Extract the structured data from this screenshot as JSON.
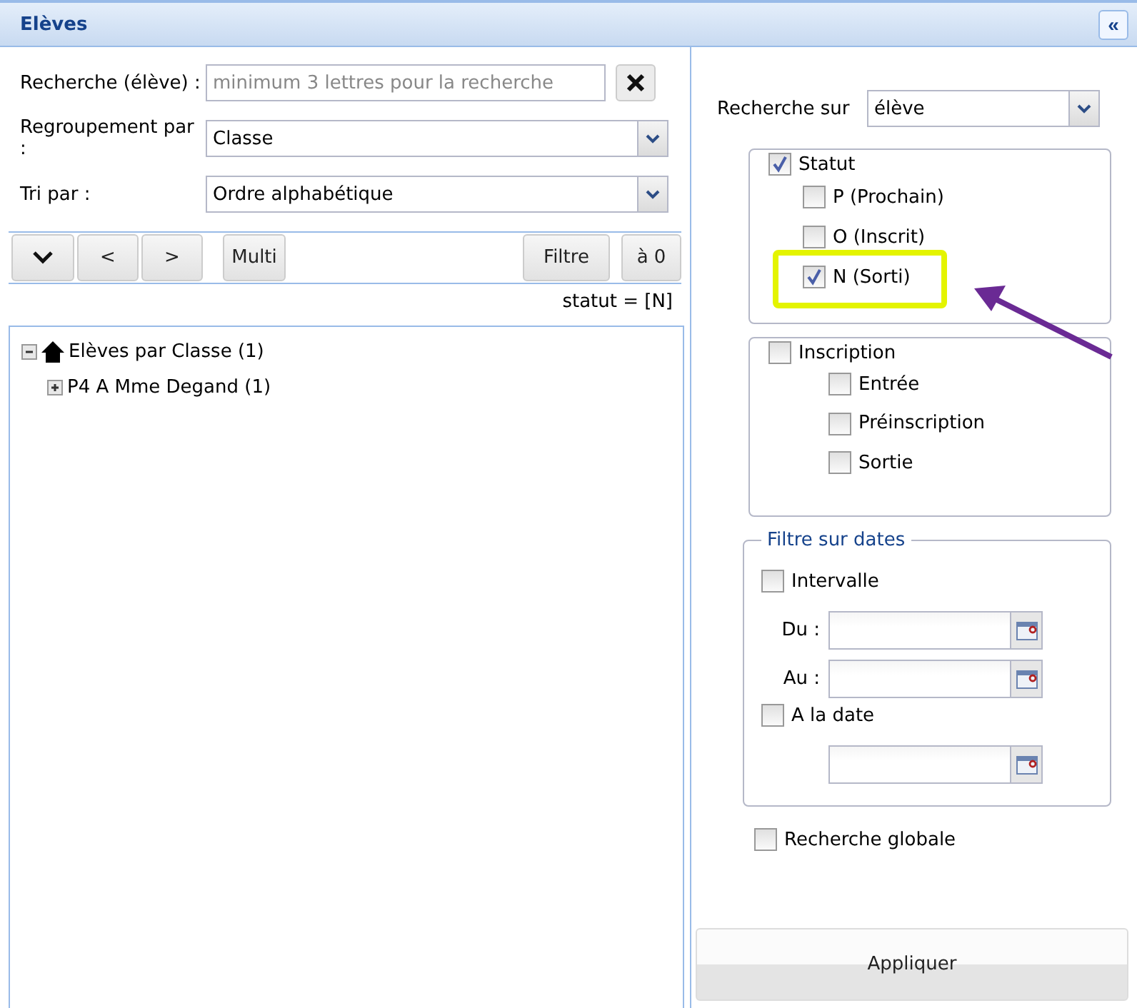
{
  "panel": {
    "title": "Elèves",
    "collapse_icon": "«"
  },
  "search": {
    "label": "Recherche (élève) :",
    "placeholder": "minimum 3 lettres pour la recherche"
  },
  "grouping": {
    "label": "Regroupement par :",
    "value": "Classe"
  },
  "sort": {
    "label": "Tri par :",
    "value": "Ordre alphabétique"
  },
  "toolbar": {
    "left": [
      "<",
      ">",
      "Multi"
    ],
    "right": [
      "Filtre",
      "à 0"
    ]
  },
  "filter_summary": "statut = [N]",
  "tree": [
    {
      "label": "Elèves par Classe (1)",
      "expanded": true,
      "children": [
        {
          "label": "P4 A Mme Degand (1)",
          "expanded": false
        }
      ]
    }
  ],
  "search_on": {
    "label": "Recherche sur",
    "value": "élève"
  },
  "groups": [
    {
      "label": "Statut",
      "checked": true,
      "items": [
        {
          "label": "P (Prochain)",
          "checked": false,
          "highlighted": false
        },
        {
          "label": "O (Inscrit)",
          "checked": false,
          "highlighted": false
        },
        {
          "label": "N (Sorti)",
          "checked": true,
          "highlighted": true
        }
      ]
    },
    {
      "label": "Inscription",
      "checked": false,
      "items": [
        {
          "label": "Entrée",
          "checked": false,
          "highlighted": false
        },
        {
          "label": "Préinscription",
          "checked": false,
          "highlighted": false
        },
        {
          "label": "Sortie",
          "checked": false,
          "highlighted": false
        }
      ]
    }
  ],
  "dates": {
    "title": "Filtre sur dates",
    "interval": {
      "label": "Intervalle",
      "checked": false
    },
    "from_label": "Du :",
    "to_label": "Au :",
    "on_date": {
      "label": "A la date",
      "checked": false
    }
  },
  "global_search": {
    "label": "Recherche globale",
    "checked": false
  },
  "apply_button": "Appliquer"
}
